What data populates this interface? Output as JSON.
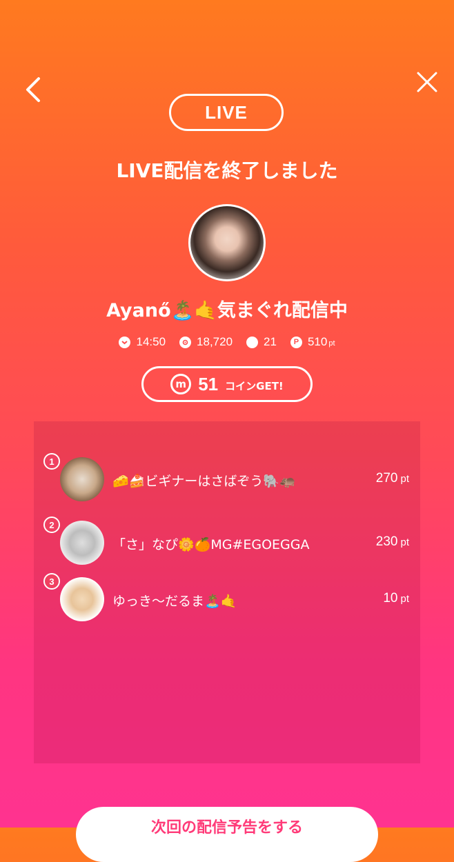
{
  "header": {
    "back_icon": "chevron-left-icon",
    "close_icon": "close-icon",
    "live_badge": "LIVE"
  },
  "title": "LIVE配信を終了しました",
  "streamer": {
    "name": "Ayanő🏝️🤙気まぐれ配信中"
  },
  "stats": {
    "duration": "14:50",
    "viewers": "18,720",
    "comments": "21",
    "points": "510",
    "points_unit": "pt"
  },
  "coin": {
    "icon_letter": "m",
    "value": "51",
    "label": "コインGET!"
  },
  "ranking": [
    {
      "rank": "1",
      "name": "🧀🍰ビギナーはさばぞう🐘🦛",
      "points": "270",
      "unit": "pt"
    },
    {
      "rank": "2",
      "name": "「さ」なぴ🌼🍊MG#EGOEGGA",
      "points": "230",
      "unit": "pt"
    },
    {
      "rank": "3",
      "name": "ゆっき〜だるま🏝️🤙",
      "points": "10",
      "unit": "pt"
    }
  ],
  "bottom_button": "次回の配信予告をする",
  "colors": {
    "gradient_top": "#ff7a1f",
    "gradient_bottom": "#ff3390",
    "badge": "#f04060",
    "button_text": "#ff3a78"
  }
}
